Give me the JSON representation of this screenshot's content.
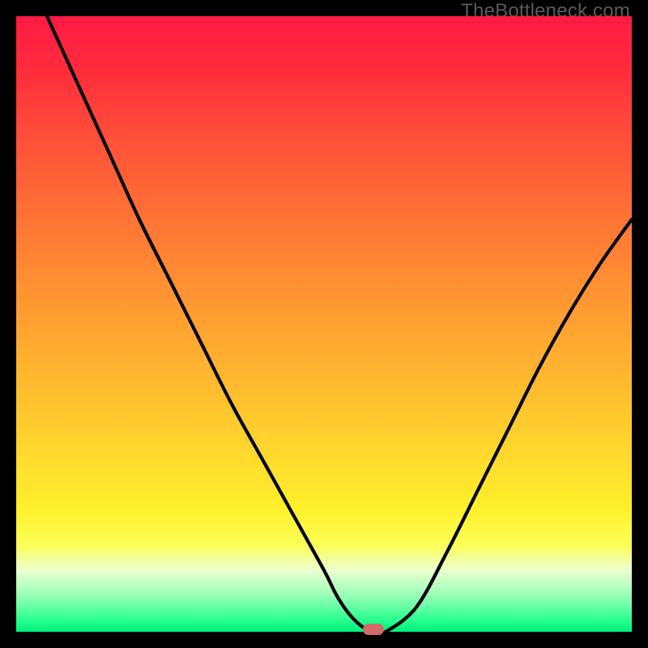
{
  "watermark": "TheBottleneck.com",
  "colors": {
    "gradient_top": "#ff1a44",
    "gradient_bottom": "#00ef7c",
    "curve": "#000000",
    "marker": "#d36a6a",
    "frame": "#000000"
  },
  "chart_data": {
    "type": "line",
    "title": "",
    "xlabel": "",
    "ylabel": "",
    "xlim": [
      0,
      100
    ],
    "ylim": [
      0,
      100
    ],
    "background": "red-to-green vertical gradient (mismatch high→low)",
    "series": [
      {
        "name": "bottleneck-curve",
        "x": [
          5,
          10,
          15,
          20,
          25,
          30,
          35,
          40,
          45,
          50,
          52,
          54,
          56,
          58,
          60,
          65,
          70,
          75,
          80,
          85,
          90,
          95,
          100
        ],
        "y": [
          100,
          89,
          78,
          67,
          57,
          47,
          37,
          28,
          19,
          10,
          6,
          3,
          1,
          0,
          0,
          4,
          13,
          23,
          33,
          43,
          52,
          60,
          67
        ]
      }
    ],
    "marker": {
      "x": 58,
      "y": 0,
      "shape": "rounded-rect",
      "color": "#d36a6a"
    },
    "grid": false,
    "legend": false
  }
}
